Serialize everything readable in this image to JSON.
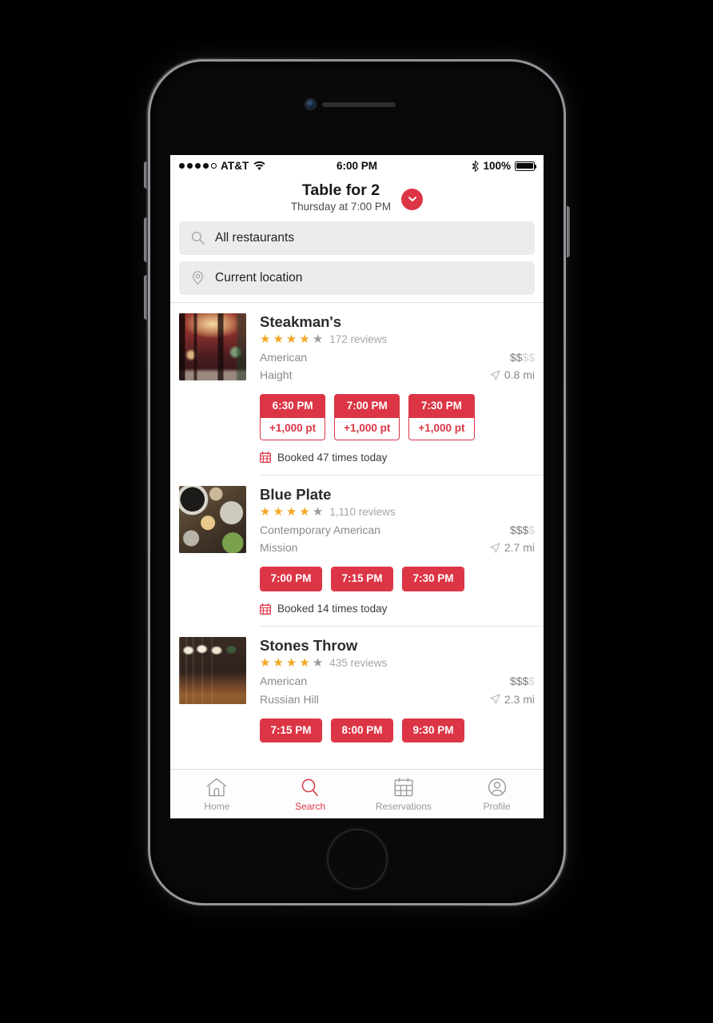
{
  "status_bar": {
    "carrier": "AT&T",
    "signal_dots_filled": 4,
    "signal_dots_total": 5,
    "wifi_icon": "wifi-icon",
    "time": "6:00 PM",
    "bluetooth_icon": "bluetooth-icon",
    "battery_percent": "100%",
    "battery_icon": "battery-full-icon"
  },
  "header": {
    "title": "Table for 2",
    "subtitle": "Thursday at 7:00 PM",
    "chevron_icon": "chevron-down-icon"
  },
  "search": {
    "restaurant_field": {
      "icon": "search-icon",
      "value": "All restaurants"
    },
    "location_field": {
      "icon": "location-pin-icon",
      "value": "Current location"
    }
  },
  "colors": {
    "accent_red": "#DC3545",
    "star_gold": "#F5A623",
    "star_empty": "#9b9b9f",
    "muted_text": "#8a8a8e"
  },
  "restaurants": [
    {
      "name": "Steakman's",
      "stars_filled": 4,
      "stars_total": 5,
      "reviews": "172 reviews",
      "cuisine": "American",
      "neighborhood": "Haight",
      "price_level": 2,
      "price_total": 4,
      "distance": "0.8 mi",
      "distance_icon": "navigation-arrow-icon",
      "slots": [
        {
          "time": "6:30 PM",
          "points": "+1,000 pt"
        },
        {
          "time": "7:00 PM",
          "points": "+1,000 pt"
        },
        {
          "time": "7:30 PM",
          "points": "+1,000 pt"
        }
      ],
      "booked_icon": "calendar-icon",
      "booked_text": "Booked 47 times today",
      "thumbnail": "restaurant-interior-warm-red"
    },
    {
      "name": "Blue Plate",
      "stars_filled": 4,
      "stars_total": 5,
      "reviews": "1,110 reviews",
      "cuisine": "Contemporary American",
      "neighborhood": "Mission",
      "price_level": 3,
      "price_total": 4,
      "distance": "2.7 mi",
      "distance_icon": "navigation-arrow-icon",
      "slots": [
        {
          "time": "7:00 PM",
          "points": ""
        },
        {
          "time": "7:15 PM",
          "points": ""
        },
        {
          "time": "7:30 PM",
          "points": ""
        }
      ],
      "booked_icon": "calendar-icon",
      "booked_text": "Booked 14 times today",
      "thumbnail": "overhead-food-table"
    },
    {
      "name": "Stones Throw",
      "stars_filled": 4,
      "stars_total": 5,
      "reviews": "435 reviews",
      "cuisine": "American",
      "neighborhood": "Russian Hill",
      "price_level": 3,
      "price_total": 4,
      "distance": "2.3 mi",
      "distance_icon": "navigation-arrow-icon",
      "slots": [
        {
          "time": "7:15 PM",
          "points": ""
        },
        {
          "time": "8:00 PM",
          "points": ""
        },
        {
          "time": "9:30 PM",
          "points": ""
        }
      ],
      "booked_icon": "calendar-icon",
      "booked_text": "",
      "thumbnail": "bar-with-pendant-lights"
    }
  ],
  "tab_bar": {
    "active": "Search",
    "tabs": [
      {
        "label": "Home",
        "icon": "home-icon"
      },
      {
        "label": "Search",
        "icon": "search-icon"
      },
      {
        "label": "Reservations",
        "icon": "calendar-grid-icon"
      },
      {
        "label": "Profile",
        "icon": "user-circle-icon"
      }
    ]
  }
}
